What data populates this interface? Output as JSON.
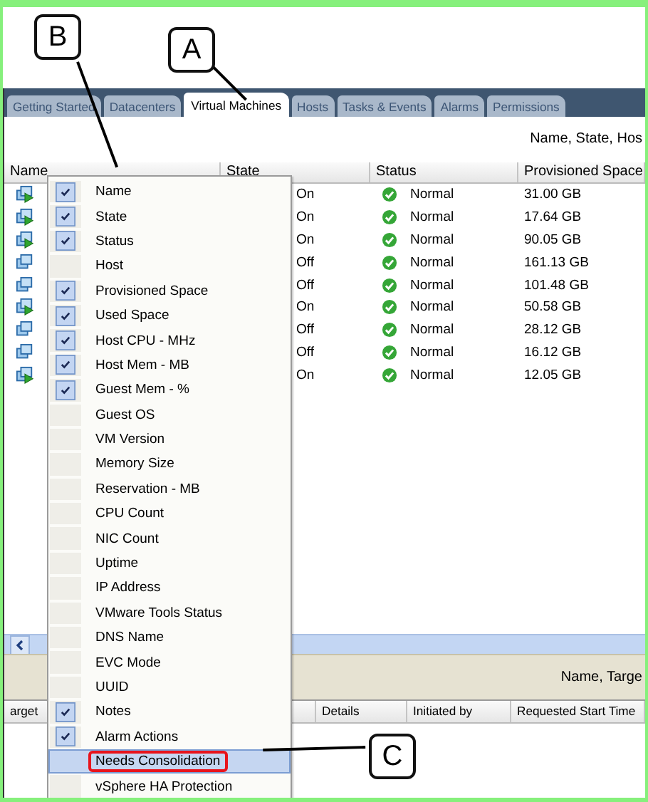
{
  "tabs": [
    {
      "label": "Getting Started",
      "selected": false
    },
    {
      "label": "Datacenters",
      "selected": false
    },
    {
      "label": "Virtual Machines",
      "selected": true
    },
    {
      "label": "Hosts",
      "selected": false
    },
    {
      "label": "Tasks & Events",
      "selected": false
    },
    {
      "label": "Alarms",
      "selected": false
    },
    {
      "label": "Permissions",
      "selected": false
    }
  ],
  "filter_label": "Name, State, Hos",
  "table": {
    "columns": [
      "Name",
      "State",
      "Status",
      "Provisioned Space"
    ],
    "rows": [
      {
        "powered_on": true,
        "state": "On",
        "status": "Normal",
        "provisioned": "31.00 GB"
      },
      {
        "powered_on": true,
        "state": "On",
        "status": "Normal",
        "provisioned": "17.64 GB"
      },
      {
        "powered_on": true,
        "state": "On",
        "status": "Normal",
        "provisioned": "90.05 GB"
      },
      {
        "powered_on": false,
        "state": "Off",
        "status": "Normal",
        "provisioned": "161.13 GB"
      },
      {
        "powered_on": false,
        "state": "Off",
        "status": "Normal",
        "provisioned": "101.48 GB"
      },
      {
        "powered_on": true,
        "state": "On",
        "status": "Normal",
        "provisioned": "50.58 GB"
      },
      {
        "powered_on": false,
        "state": "Off",
        "status": "Normal",
        "provisioned": "28.12 GB"
      },
      {
        "powered_on": false,
        "state": "Off",
        "status": "Normal",
        "provisioned": "16.12 GB"
      },
      {
        "powered_on": true,
        "state": "On",
        "status": "Normal",
        "provisioned": "12.05 GB"
      }
    ]
  },
  "tasks_panel": {
    "filter_label": "Name, Targe",
    "columns": [
      "arget",
      "Details",
      "Initiated by",
      "Requested Start Time"
    ]
  },
  "column_menu": [
    {
      "label": "Name",
      "checked": true,
      "selected": false,
      "highlighted": false
    },
    {
      "label": "State",
      "checked": true,
      "selected": false,
      "highlighted": false
    },
    {
      "label": "Status",
      "checked": true,
      "selected": false,
      "highlighted": false
    },
    {
      "label": "Host",
      "checked": false,
      "selected": false,
      "highlighted": false
    },
    {
      "label": "Provisioned Space",
      "checked": true,
      "selected": false,
      "highlighted": false
    },
    {
      "label": "Used Space",
      "checked": true,
      "selected": false,
      "highlighted": false
    },
    {
      "label": "Host CPU - MHz",
      "checked": true,
      "selected": false,
      "highlighted": false
    },
    {
      "label": "Host Mem - MB",
      "checked": true,
      "selected": false,
      "highlighted": false
    },
    {
      "label": "Guest Mem - %",
      "checked": true,
      "selected": false,
      "highlighted": false
    },
    {
      "label": "Guest OS",
      "checked": false,
      "selected": false,
      "highlighted": false
    },
    {
      "label": "VM Version",
      "checked": false,
      "selected": false,
      "highlighted": false
    },
    {
      "label": "Memory Size",
      "checked": false,
      "selected": false,
      "highlighted": false
    },
    {
      "label": "Reservation - MB",
      "checked": false,
      "selected": false,
      "highlighted": false
    },
    {
      "label": "CPU Count",
      "checked": false,
      "selected": false,
      "highlighted": false
    },
    {
      "label": "NIC Count",
      "checked": false,
      "selected": false,
      "highlighted": false
    },
    {
      "label": "Uptime",
      "checked": false,
      "selected": false,
      "highlighted": false
    },
    {
      "label": "IP Address",
      "checked": false,
      "selected": false,
      "highlighted": false
    },
    {
      "label": "VMware Tools Status",
      "checked": false,
      "selected": false,
      "highlighted": false
    },
    {
      "label": "DNS Name",
      "checked": false,
      "selected": false,
      "highlighted": false
    },
    {
      "label": "EVC Mode",
      "checked": false,
      "selected": false,
      "highlighted": false
    },
    {
      "label": "UUID",
      "checked": false,
      "selected": false,
      "highlighted": false
    },
    {
      "label": "Notes",
      "checked": true,
      "selected": false,
      "highlighted": false
    },
    {
      "label": "Alarm Actions",
      "checked": true,
      "selected": false,
      "highlighted": false
    },
    {
      "label": "Needs Consolidation",
      "checked": false,
      "selected": true,
      "highlighted": true
    },
    {
      "label": "vSphere HA Protection",
      "checked": false,
      "selected": false,
      "highlighted": false
    }
  ],
  "callouts": [
    {
      "label": "B"
    },
    {
      "label": "A"
    },
    {
      "label": "C"
    }
  ]
}
